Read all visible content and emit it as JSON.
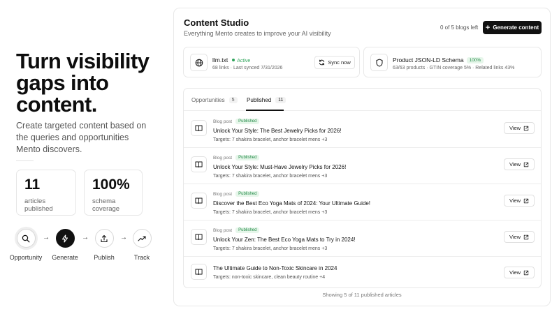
{
  "hero": {
    "title": "Turn visibility gaps into content.",
    "subtitle": "Create targeted content based on the queries and opportunities Mento discovers.",
    "stats": [
      {
        "value": "11",
        "label": "articles published"
      },
      {
        "value": "100%",
        "label": "schema coverage"
      }
    ],
    "flow": [
      {
        "label": "Opportunity",
        "icon": "search-icon"
      },
      {
        "label": "Generate",
        "icon": "lightning-icon"
      },
      {
        "label": "Publish",
        "icon": "upload-icon"
      },
      {
        "label": "Track",
        "icon": "trend-icon"
      }
    ]
  },
  "studio": {
    "title": "Content Studio",
    "subtitle": "Everything Mento creates to improve your AI visibility",
    "quota": "0 of 5 blogs left",
    "generate_label": "Generate content",
    "llm": {
      "name": "llm.txt",
      "status": "Active",
      "meta": "68 links · Last synced 7/31/2026",
      "sync_label": "Sync now"
    },
    "schema": {
      "name": "Product JSON-LD Schema",
      "badge": "100%",
      "meta": "63/63 products · GTIN coverage 5% · Related links 43%"
    },
    "tabs": [
      {
        "label": "Opportunities",
        "count": "5"
      },
      {
        "label": "Published",
        "count": "11"
      }
    ],
    "active_tab": "Published",
    "view_label": "View",
    "articles": [
      {
        "type": "Blog post",
        "status": "Published",
        "title": "Unlock Your Style: The Best Jewelry Picks for 2026!",
        "targets": "Targets: 7 shakira bracelet, anchor bracelet mens +3"
      },
      {
        "type": "Blog post",
        "status": "Published",
        "title": "Unlock Your Style: Must-Have Jewelry Picks for 2026!",
        "targets": "Targets: 7 shakira bracelet, anchor bracelet mens +3"
      },
      {
        "type": "Blog post",
        "status": "Published",
        "title": "Discover the Best Eco Yoga Mats of 2024: Your Ultimate Guide!",
        "targets": "Targets: 7 shakira bracelet, anchor bracelet mens +3"
      },
      {
        "type": "Blog post",
        "status": "Published",
        "title": "Unlock Your Zen: The Best Eco Yoga Mats to Try in 2024!",
        "targets": "Targets: 7 shakira bracelet, anchor bracelet mens +3"
      },
      {
        "type": "",
        "status": "",
        "title": "The Ultimate Guide to Non-Toxic Skincare in 2024",
        "targets": "Targets: non-toxic skincare, clean beauty routine +4"
      }
    ],
    "footer": "Showing 5 of 11 published articles"
  }
}
